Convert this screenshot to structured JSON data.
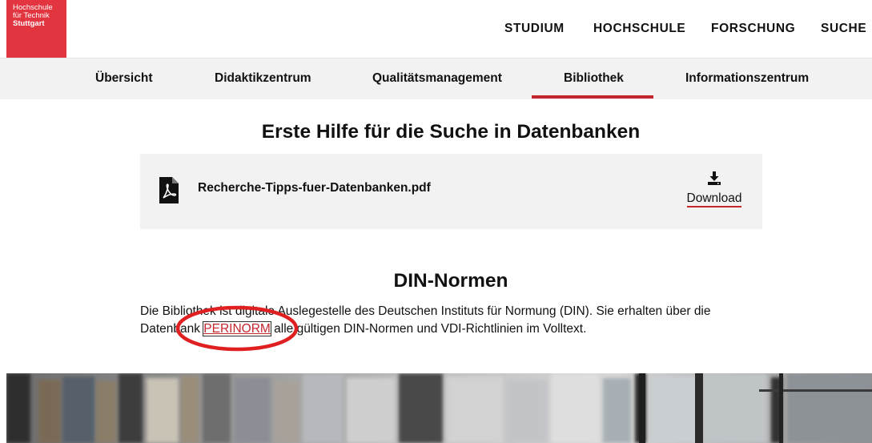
{
  "header": {
    "logo_lines": [
      "Hochschule",
      "für Technik",
      "Stuttgart"
    ],
    "nav": [
      "STUDIUM",
      "HOCHSCHULE",
      "FORSCHUNG",
      "SUCHE"
    ]
  },
  "subnav": {
    "items": [
      "Übersicht",
      "Didaktikzentrum",
      "Qualitätsmanagement",
      "Bibliothek",
      "Informationszentrum"
    ],
    "active": "Bibliothek"
  },
  "section_first_aid": {
    "title": "Erste Hilfe für die Suche in Datenbanken",
    "file_name": "Recherche-Tipps-fuer-Datenbanken.pdf",
    "download_label": "Download"
  },
  "section_din": {
    "title": "DIN-Normen",
    "text_before": "Die Bibliothek ist digitale Auslegestelle des Deutschen Instituts für Normung (DIN). Sie erhalten über die Datenbank ",
    "link": "PERINORM",
    "text_after": " alle gültigen DIN-Normen und VDI-Richtlinien im Volltext."
  },
  "colors": {
    "brand_red": "#e3353f",
    "accent_red": "#c4262e",
    "annotation_red": "#e02020",
    "panel_gray": "#f2f2f2"
  },
  "icons": {
    "file": "pdf-file-icon",
    "download": "download-icon"
  }
}
